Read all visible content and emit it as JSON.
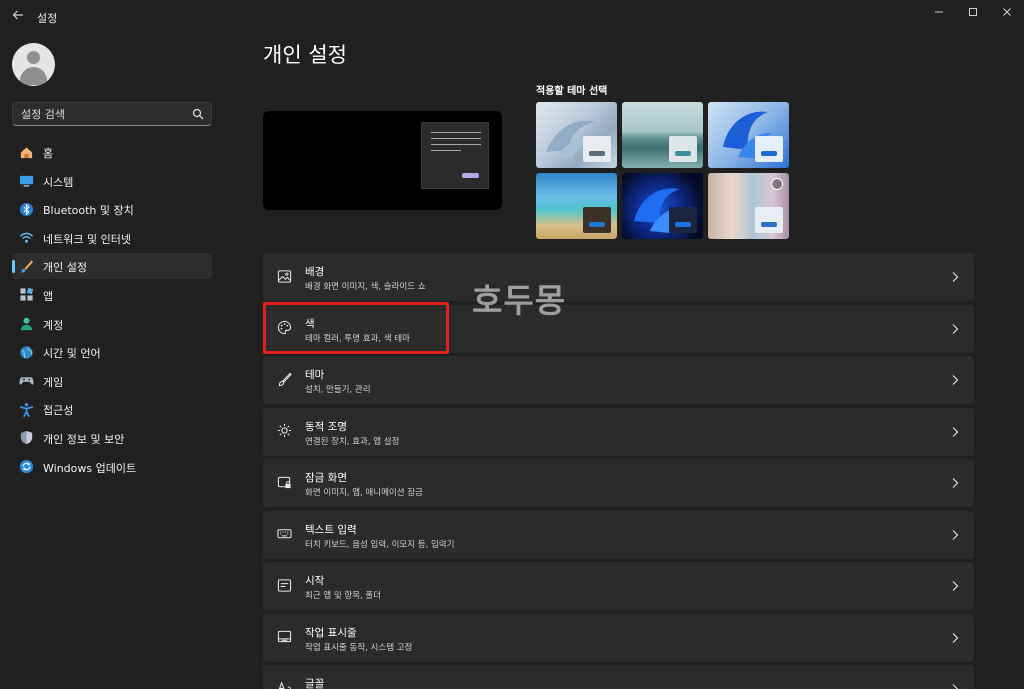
{
  "titlebar": {
    "app_title": "설정"
  },
  "sidebar": {
    "search_placeholder": "설정 검색",
    "items": [
      {
        "label": "홈",
        "icon": "home-icon"
      },
      {
        "label": "시스템",
        "icon": "system-icon"
      },
      {
        "label": "Bluetooth 및 장치",
        "icon": "bluetooth-icon"
      },
      {
        "label": "네트워크 및 인터넷",
        "icon": "wifi-icon"
      },
      {
        "label": "개인 설정",
        "icon": "brush-icon",
        "active": true
      },
      {
        "label": "앱",
        "icon": "apps-icon"
      },
      {
        "label": "계정",
        "icon": "account-icon"
      },
      {
        "label": "시간 및 언어",
        "icon": "globe-icon"
      },
      {
        "label": "게임",
        "icon": "gamepad-icon"
      },
      {
        "label": "접근성",
        "icon": "accessibility-icon"
      },
      {
        "label": "개인 정보 및 보안",
        "icon": "shield-icon"
      },
      {
        "label": "Windows 업데이트",
        "icon": "update-icon"
      }
    ]
  },
  "main": {
    "page_title": "개인 설정",
    "theme_label": "적용할 테마 선택",
    "themes": [
      {
        "name": "bloom-light",
        "chip": "#e8ebf0",
        "bar": "#5c6b7a"
      },
      {
        "name": "lake",
        "chip": "#dde7ea",
        "bar": "#3f8f9b"
      },
      {
        "name": "bloom-blue-light",
        "chip": "#e6eef8",
        "bar": "#1a6cd1"
      },
      {
        "name": "beach",
        "chip": "#3b3026",
        "bar": "#1e78d0"
      },
      {
        "name": "bloom-dark",
        "chip": "#1b2440",
        "bar": "#1e72dd"
      },
      {
        "name": "flowers",
        "chip": "#e9edf4",
        "bar": "#2a70c9"
      }
    ],
    "cards": [
      {
        "title": "배경",
        "subtitle": "배경 화면 이미지, 색, 슬라이드 쇼",
        "icon": "picture-icon"
      },
      {
        "title": "색",
        "subtitle": "테마 컬러, 투명 효과, 색 테마",
        "icon": "palette-icon"
      },
      {
        "title": "테마",
        "subtitle": "설치, 만들기, 관리",
        "icon": "brush-icon"
      },
      {
        "title": "동적 조명",
        "subtitle": "연결된 장치, 효과, 앱 설정",
        "icon": "lighting-icon"
      },
      {
        "title": "잠금 화면",
        "subtitle": "화면 이미지, 앱, 애니메이션 잠금",
        "icon": "lock-screen-icon"
      },
      {
        "title": "텍스트 입력",
        "subtitle": "터치 키보드, 음성 입력, 이모지 등, 입력기",
        "icon": "keyboard-icon"
      },
      {
        "title": "시작",
        "subtitle": "최근 앱 및 항목, 폴더",
        "icon": "start-icon"
      },
      {
        "title": "작업 표시줄",
        "subtitle": "작업 표시줄 동작, 시스템 고정",
        "icon": "taskbar-icon"
      },
      {
        "title": "글꼴",
        "subtitle": "",
        "icon": "font-icon"
      }
    ]
  },
  "watermark": "호두몽",
  "colors": {
    "accent": "#60cdff",
    "highlight": "#e0201c",
    "background": "#202020",
    "card": "#2b2b2b"
  }
}
